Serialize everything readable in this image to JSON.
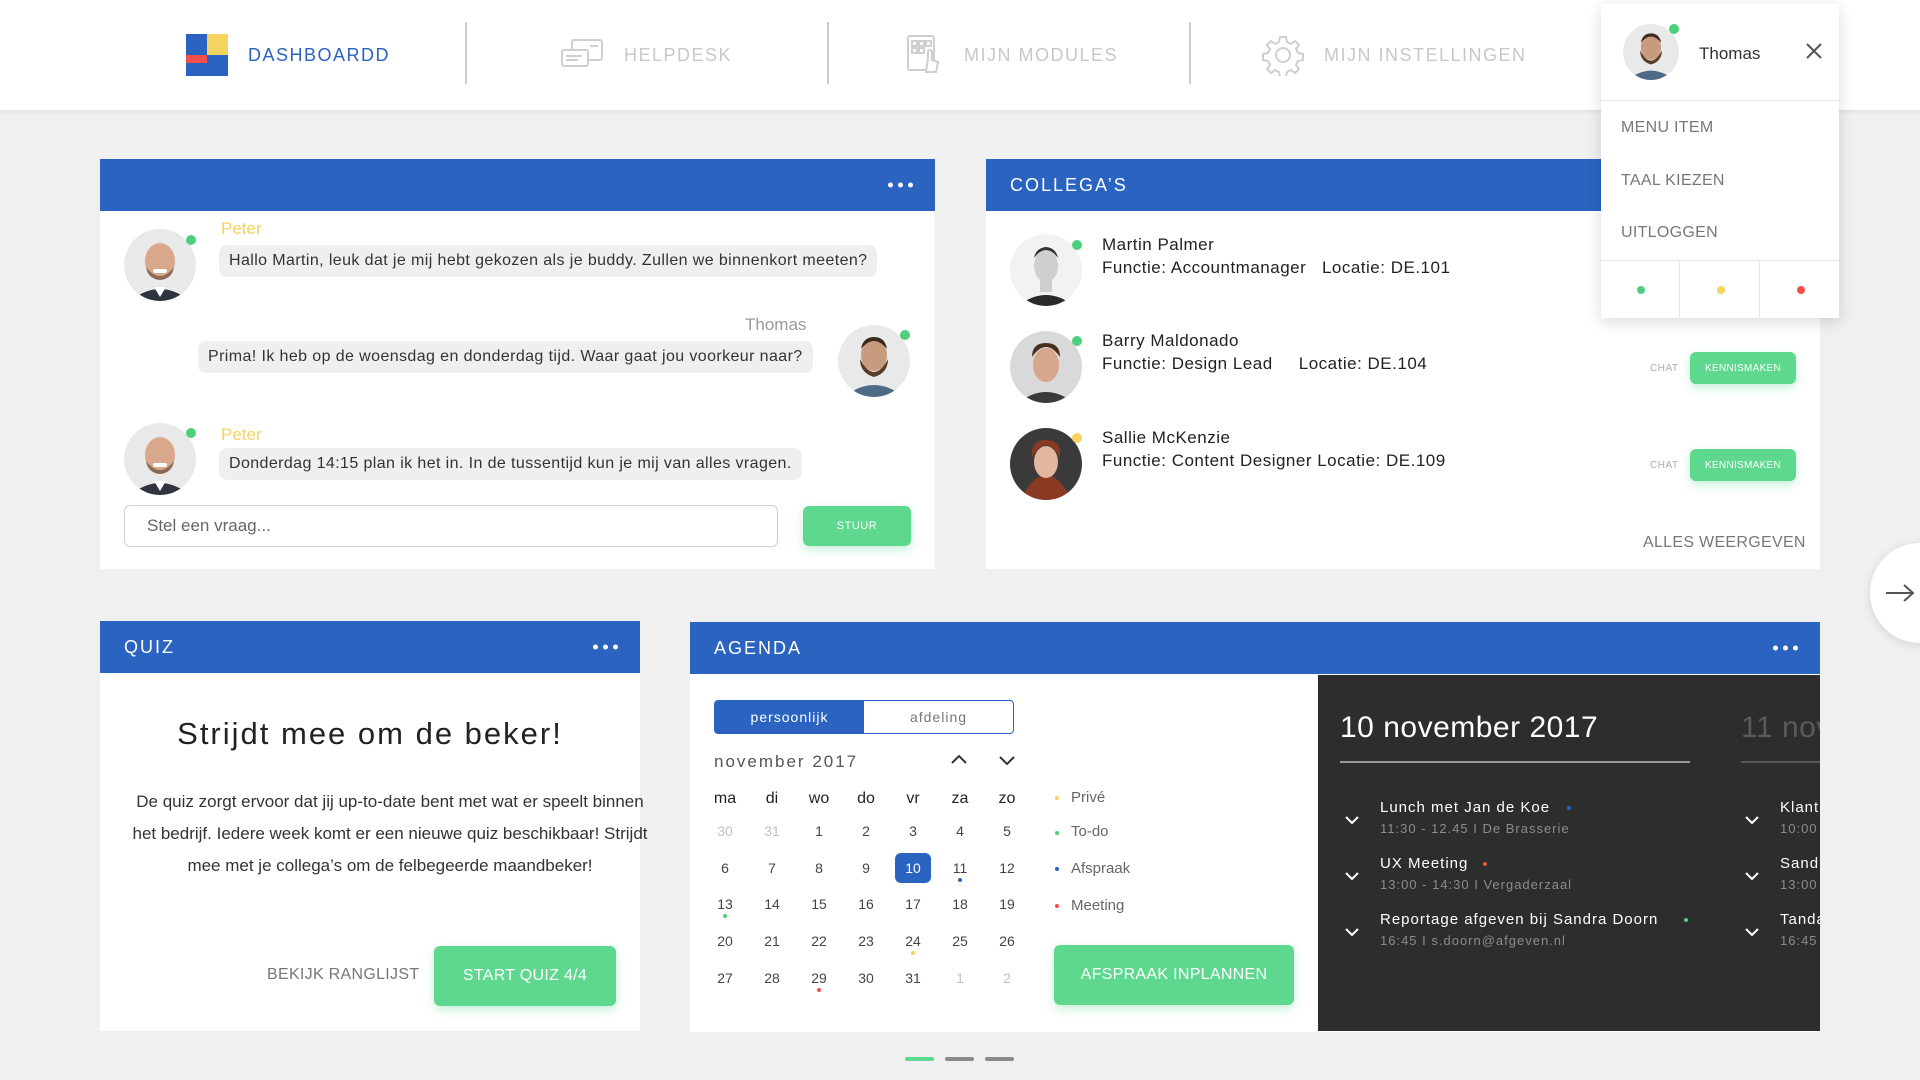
{
  "nav": {
    "items": [
      {
        "label": "DASHBOARDD",
        "icon": "dashboard-grid-icon",
        "active": true
      },
      {
        "label": "HELPDESK",
        "icon": "chat-bubbles-icon",
        "active": false
      },
      {
        "label": "MIJN MODULES",
        "icon": "modules-tap-icon",
        "active": false
      },
      {
        "label": "MIJN INSTELLINGEN",
        "icon": "gear-icon",
        "active": false
      }
    ]
  },
  "user_menu": {
    "name": "Thomas",
    "close_icon": "close-icon",
    "items": [
      "MENU ITEM",
      "TAAL KIEZEN",
      "UITLOGGEN"
    ],
    "status_options": [
      {
        "status": "online",
        "color": "#4cd07d"
      },
      {
        "status": "away",
        "color": "#f4d35e"
      },
      {
        "status": "busy",
        "color": "#f0504a"
      }
    ]
  },
  "chat": {
    "messages": [
      {
        "sender": "Peter",
        "text": "Hallo Martin, leuk dat je mij hebt gekozen als je buddy. Zullen we binnenkort meeten?"
      },
      {
        "sender": "Thomas",
        "text": "Prima! Ik heb op de woensdag en donderdag tijd. Waar gaat jou voorkeur naar?"
      },
      {
        "sender": "Peter",
        "text": "Donderdag 14:15 plan ik het in. In de tussentijd kun je mij van alles vragen."
      }
    ],
    "input_placeholder": "Stel een vraag...",
    "send_label": "STUUR"
  },
  "colleagues": {
    "title": "COLLEGA’S",
    "people": [
      {
        "name": "Martin Palmer",
        "meta": "Functie: Accountmanager   Locatie: DE.101",
        "status_color": "#4cd07d",
        "chat_label": "",
        "action_label": ""
      },
      {
        "name": "Barry Maldonado",
        "meta": "Functie: Design Lead     Locatie: DE.104",
        "status_color": "#4cd07d",
        "chat_label": "CHAT",
        "action_label": "KENNISMAKEN"
      },
      {
        "name": "Sallie McKenzie",
        "meta": "Functie: Content Designer Locatie: DE.109",
        "status_color": "#f4d35e",
        "chat_label": "CHAT",
        "action_label": "KENNISMAKEN"
      }
    ],
    "show_all": "ALLES WEERGEVEN"
  },
  "quiz": {
    "header": "QUIZ",
    "title": "Strijdt mee om de beker!",
    "description": "De quiz zorgt ervoor dat jij up-to-date bent met wat er speelt binnen het bedrijf. Iedere week komt er een nieuwe quiz beschikbaar! Strijdt mee met je collega’s om de felbegeerde maandbeker!",
    "ranking_label": "BEKIJK RANGLIJST",
    "start_label": "START QUIZ 4/4"
  },
  "agenda": {
    "header": "AGENDA",
    "tabs": [
      "persoonlijk",
      "afdeling"
    ],
    "active_tab": "persoonlijk",
    "month_label": "november 2017",
    "weekdays": [
      "ma",
      "di",
      "wo",
      "do",
      "vr",
      "za",
      "zo"
    ],
    "weeks": [
      [
        "30",
        "31",
        "1",
        "2",
        "3",
        "4",
        "5"
      ],
      [
        "6",
        "7",
        "8",
        "9",
        "10",
        "11",
        "12"
      ],
      [
        "13",
        "14",
        "15",
        "16",
        "17",
        "18",
        "19"
      ],
      [
        "20",
        "21",
        "22",
        "23",
        "24",
        "25",
        "26"
      ],
      [
        "27",
        "28",
        "29",
        "30",
        "31",
        "1",
        "2"
      ]
    ],
    "selected_day": "10",
    "legend": [
      {
        "label": "Privé",
        "color": "#f4d35e"
      },
      {
        "label": "To-do",
        "color": "#4cd07d"
      },
      {
        "label": "Afspraak",
        "color": "#2a63c0"
      },
      {
        "label": "Meeting",
        "color": "#f0504a"
      }
    ],
    "plan_label": "AFSPRAAK INPLANNEN",
    "day_panels": [
      {
        "date": "10 november 2017",
        "events": [
          {
            "title": "Lunch met Jan de Koe",
            "sub": "11:30 - 12.45 I De Brasserie",
            "color": "#2a63c0"
          },
          {
            "title": "UX Meeting",
            "sub": "13:00 - 14:30 I Vergaderzaal",
            "color": "#f0504a"
          },
          {
            "title": "Reportage afgeven bij Sandra Doorn",
            "sub": "16:45 I s.doorn@afgeven.nl",
            "color": "#4cd07d"
          }
        ]
      },
      {
        "date": "11 nov",
        "events": [
          {
            "title": "Klant",
            "sub": "10:00"
          },
          {
            "title": "Sandr",
            "sub": "13:00"
          },
          {
            "title": "Tanda",
            "sub": "16:45"
          }
        ]
      }
    ]
  },
  "pager": {
    "pages": 3,
    "active_index": 0
  },
  "colors": {
    "primary": "#2a63c0",
    "accent_green": "#5ed78f",
    "dark_panel": "#2d2d2d"
  }
}
